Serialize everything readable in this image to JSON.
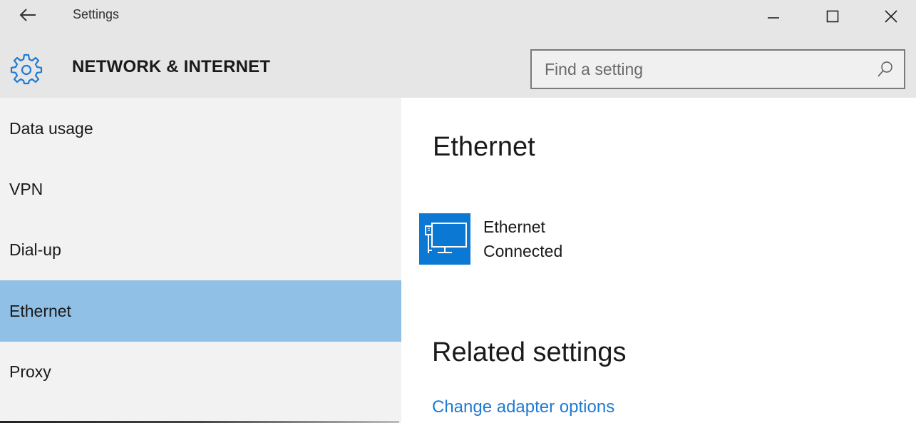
{
  "window": {
    "app_title": "Settings",
    "controls": [
      "minimize",
      "maximize",
      "close"
    ]
  },
  "header": {
    "section_title": "NETWORK & INTERNET",
    "section_icon": "gear-icon",
    "search": {
      "placeholder": "Find a setting",
      "value": ""
    }
  },
  "sidebar": {
    "items": [
      {
        "label": "Data usage",
        "active": false
      },
      {
        "label": "VPN",
        "active": false
      },
      {
        "label": "Dial-up",
        "active": false
      },
      {
        "label": "Ethernet",
        "active": true
      },
      {
        "label": "Proxy",
        "active": false
      }
    ]
  },
  "main": {
    "title": "Ethernet",
    "device": {
      "name": "Ethernet",
      "status": "Connected",
      "icon": "ethernet-monitor-icon"
    },
    "related_title": "Related settings",
    "links": [
      "Change adapter options"
    ]
  },
  "colors": {
    "accent": "#0b78d4",
    "selection": "#90c0e6",
    "link": "#1e7bd2",
    "header_bg": "#e6e6e6",
    "sidebar_bg": "#f2f2f2"
  }
}
